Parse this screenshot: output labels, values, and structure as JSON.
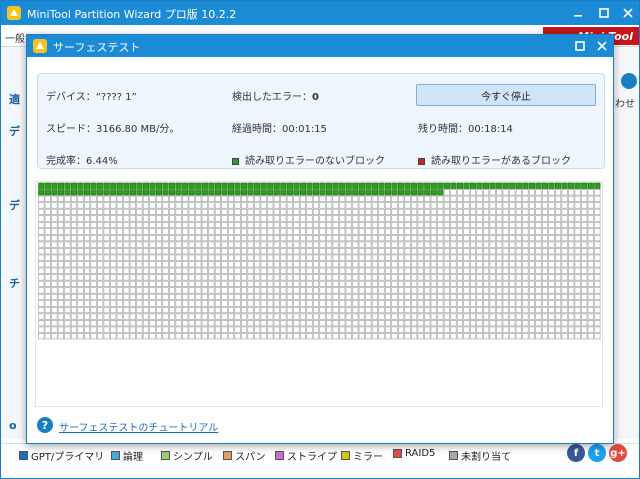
{
  "app": {
    "title": "MiniTool Partition Wizard プロ版 10.2.2",
    "menu_fragment": "一般",
    "brand_fragment": "Mini Tool",
    "left_fragments": [
      "適",
      "デ",
      "デ",
      "チ",
      "o"
    ],
    "right_fragment": "わせ"
  },
  "dialog": {
    "title": "サーフェステスト",
    "device_label": "デバイス：“???? 1”",
    "errors_label": "検出したエラー：",
    "errors_value": "0",
    "stop_button": "今すぐ停止",
    "speed_label": "スピード：3166.80 MB/分。",
    "elapsed_label": "経過時間：",
    "elapsed_value": "00:01:15",
    "remaining_label": "残り時間：",
    "remaining_value": "00:18:14",
    "completion_label": "完成率：6.44%",
    "legend_ok": "読み取りエラーのないブロック",
    "legend_err": "読み取りエラーがあるブロック",
    "tutorial_link": "サーフェステストのチュートリアル"
  },
  "scan": {
    "progress_percent": 6.44,
    "scanned_blocks": 148,
    "total_blocks": 2064,
    "error_blocks": 0
  },
  "colors": {
    "titlebar": "#1b8bd6",
    "ok_block": "#2e9e1f",
    "err_block": "#d0202a",
    "pending_block": "#ffffff"
  },
  "legend": [
    {
      "label": "GPT/プライマリ",
      "color": "#1b6fc4"
    },
    {
      "label": "論理",
      "color": "#48a8e0"
    },
    {
      "label": "シンプル",
      "color": "#9ccf6a"
    },
    {
      "label": "スパン",
      "color": "#e1a060"
    },
    {
      "label": "ストライプ",
      "color": "#cf6fc8"
    },
    {
      "label": "ミラー",
      "color": "#d6c21c"
    },
    {
      "label": "RAID5",
      "color": "#e0504a"
    },
    {
      "label": "未割り当て",
      "color": "#a8a8a8"
    }
  ],
  "social": [
    {
      "name": "facebook-icon",
      "glyph": "f",
      "color": "#3b5998"
    },
    {
      "name": "twitter-icon",
      "glyph": "t",
      "color": "#1da1f2"
    },
    {
      "name": "google-plus-icon",
      "glyph": "g+",
      "color": "#dc4e41"
    }
  ]
}
